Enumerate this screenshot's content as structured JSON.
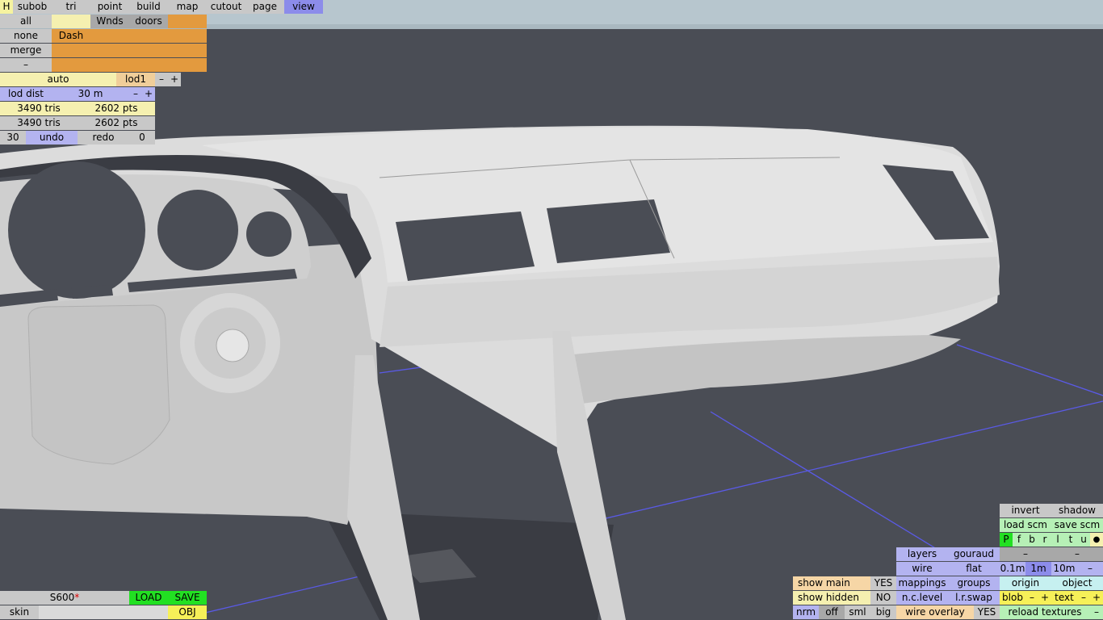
{
  "menu": {
    "h": "H",
    "items": [
      "subob",
      "tri",
      "point",
      "build",
      "map",
      "cutout",
      "page",
      "view"
    ],
    "active": "view"
  },
  "selector": {
    "all": "all",
    "none": "none",
    "merge": "merge",
    "minus": "–",
    "tabs": [
      "",
      "Wnds",
      "doors",
      ""
    ],
    "current": "Dash"
  },
  "lod": {
    "mode": "auto",
    "level": "lod1",
    "minus": "–",
    "plus": "+",
    "dist_label": "lod dist",
    "dist_value": "30 m",
    "tris1": "3490 tris",
    "pts1": "2602 pts",
    "tris2": "3490 tris",
    "pts2": "2602 pts"
  },
  "history": {
    "count": "30",
    "undo": "undo",
    "redo": "redo",
    "redo_count": "0"
  },
  "file": {
    "name": "S600",
    "modified_mark": "*",
    "load": "LOAD",
    "save": "SAVE",
    "skin": "skin",
    "skin_value": "",
    "obj": "OBJ"
  },
  "view_panel": {
    "invert": "invert",
    "shadow": "shadow",
    "load_scm": "load scm",
    "save_scm": "save scm",
    "views": [
      "P",
      "f",
      "b",
      "r",
      "l",
      "t",
      "u"
    ],
    "dot": "●",
    "minus": "–",
    "layers": "layers",
    "gouraud": "gouraud",
    "wire": "wire",
    "flat": "flat",
    "grid": [
      "0.1m",
      "1m",
      "10m"
    ],
    "mappings": "mappings",
    "groups": "groups",
    "origin": "origin",
    "object": "object",
    "nclevel": "n.c.level",
    "lrswap": "l.r.swap",
    "blob": "blob",
    "text": "text",
    "plus": "+",
    "show_main": "show main",
    "show_main_value": "YES",
    "show_hidden": "show hidden",
    "show_hidden_value": "NO",
    "size_modes": [
      "nrm",
      "off",
      "sml",
      "big"
    ],
    "wire_overlay": "wire overlay",
    "wire_overlay_value": "YES",
    "reload_textures": "reload textures"
  },
  "colors": {
    "background": "#4a4d55",
    "sky": "#b7c6ce",
    "model": "#dcdcdc",
    "grid_line": "#5a5ae6",
    "axis": "#40d0d0"
  }
}
